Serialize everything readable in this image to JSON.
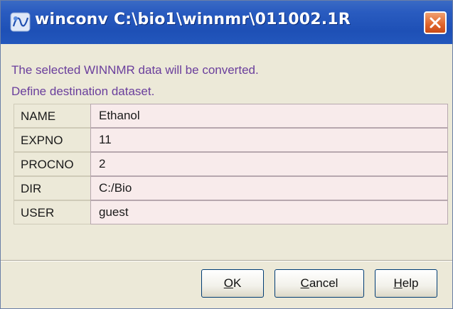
{
  "window": {
    "title": "winconv C:\\bio1\\winnmr\\011002.1R",
    "accent_color": "#2a5cc0",
    "close_color": "#e0642a",
    "icons": [
      "app-icon",
      "close-icon"
    ]
  },
  "message": {
    "line1": "The selected WINNMR data will be converted.",
    "line2": "Define destination dataset.",
    "color": "#6a3e9c"
  },
  "fields": [
    {
      "label": "NAME",
      "value": "Ethanol"
    },
    {
      "label": "EXPNO",
      "value": "11"
    },
    {
      "label": "PROCNO",
      "value": "2"
    },
    {
      "label": "DIR",
      "value": "C:/Bio"
    },
    {
      "label": "USER",
      "value": "guest"
    }
  ],
  "buttons": {
    "ok": {
      "mnemonic": "O",
      "rest": "K"
    },
    "cancel": {
      "mnemonic": "C",
      "rest": "ancel"
    },
    "help": {
      "mnemonic": "H",
      "rest": "elp"
    }
  }
}
